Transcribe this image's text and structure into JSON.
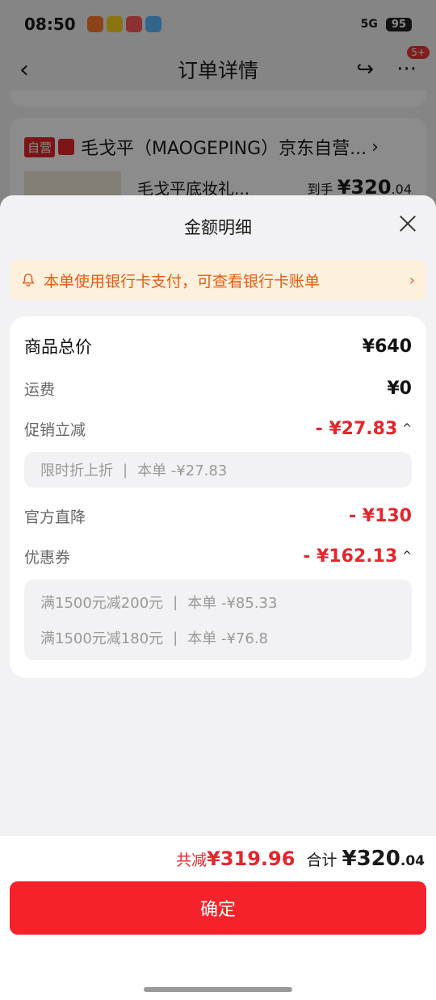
{
  "status_bar": {
    "time": "08:50",
    "network": "5G",
    "battery": "95"
  },
  "nav": {
    "back_glyph": "‹",
    "title": "订单详情",
    "share_glyph": "↪",
    "more_glyph": "···",
    "badge": "5+"
  },
  "store": {
    "tag_self": "自营",
    "name": "毛戈平（MAOGEPING）京东自营...",
    "chevron": "›"
  },
  "product": {
    "name": "毛戈平底妆礼...",
    "price_label": "到手",
    "price_main": "¥320",
    "price_decimal": ".04"
  },
  "sheet": {
    "title": "金额明细"
  },
  "notice": {
    "text": "本单使用银行卡支付，可查看银行卡账单",
    "chevron": "›"
  },
  "rows": {
    "goods_total": {
      "label": "商品总价",
      "value": "¥640"
    },
    "shipping": {
      "label": "运费",
      "value": "¥0"
    },
    "promo": {
      "label": "促销立减",
      "value": "- ¥27.83"
    },
    "official": {
      "label": "官方直降",
      "value": "- ¥130"
    },
    "coupon": {
      "label": "优惠券",
      "value": "- ¥162.13"
    }
  },
  "promo_detail": [
    {
      "name": "限时折上折",
      "amount": "本单 -¥27.83"
    }
  ],
  "coupon_detail": [
    {
      "name": "满1500元减200元",
      "amount": "本单 -¥85.33"
    },
    {
      "name": "满1500元减180元",
      "amount": "本单 -¥76.8"
    }
  ],
  "summary": {
    "reduce_label": "共减",
    "reduce_value": "¥319.96",
    "total_label": "合计",
    "total_main": "¥320",
    "total_decimal": ".04"
  },
  "confirm_label": "确定",
  "caret_up": "^",
  "colors": {
    "accent": "#f5212b",
    "price_red": "#e4262d",
    "notice_bg": "#fdf1dd",
    "notice_text": "#e45b14"
  }
}
